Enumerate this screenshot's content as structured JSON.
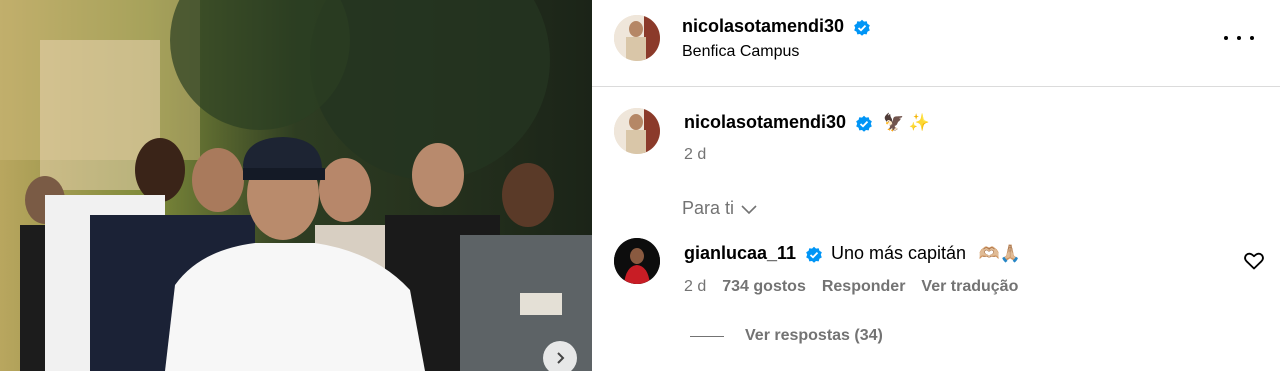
{
  "post": {
    "author": "nicolasotamendi30",
    "location": "Benfica Campus"
  },
  "caption": {
    "author": "nicolasotamendi30",
    "emojis": "🦅 ✨",
    "time": "2 d"
  },
  "filter": {
    "label": "Para ti"
  },
  "comment": {
    "author": "gianlucaa_11",
    "text": "Uno más capitán",
    "emojis": "🫶🏼🙏🏼",
    "time": "2 d",
    "likes": "734 gostos",
    "reply_label": "Responder",
    "translate_label": "Ver tradução",
    "replies_label": "Ver respostas (34)"
  },
  "colors": {
    "verified": "#0095f6",
    "muted": "#737373",
    "divider": "#dbdbdb"
  },
  "icons": {
    "verified": "verified-badge-icon",
    "more": "more-options-icon",
    "chevron": "chevron-down-icon",
    "heart": "heart-icon",
    "next": "chevron-right-icon"
  }
}
